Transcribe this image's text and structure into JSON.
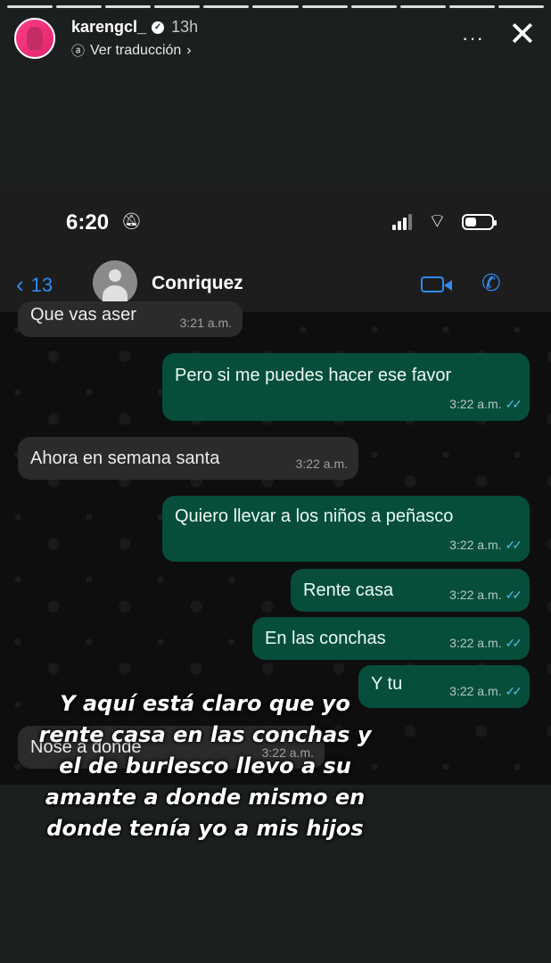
{
  "story": {
    "username": "karengcl_",
    "verified_mark": "✓",
    "time": "13h",
    "translate": "Ver traducción",
    "more": "···",
    "close": "✕",
    "caption": "Y aquí está claro que yo rente casa en las conchas y el de burlesco llevo a su amante a donde mismo en donde tenía yo a mis hijos"
  },
  "phone": {
    "time": "6:20",
    "back_count": "13",
    "contact": "Conriquez"
  },
  "messages": [
    {
      "dir": "in",
      "text": "Que vas aser",
      "time": "3:21 a.m."
    },
    {
      "dir": "out",
      "text": "Pero si me puedes hacer ese favor",
      "time": "3:22 a.m."
    },
    {
      "dir": "in",
      "text": "Ahora en semana santa",
      "time": "3:22 a.m."
    },
    {
      "dir": "out",
      "text": "Quiero llevar a los niños a peñasco",
      "time": "3:22 a.m."
    },
    {
      "dir": "out",
      "text": "Rente casa",
      "time": "3:22 a.m."
    },
    {
      "dir": "out",
      "text": "En las conchas",
      "time": "3:22 a.m."
    },
    {
      "dir": "out",
      "text": "Y tu",
      "time": "3:22 a.m."
    },
    {
      "dir": "in",
      "text": "Nose a donde",
      "time": "3:22 a.m."
    }
  ],
  "icons": {
    "bell_muted": "bell-slash-icon",
    "wifi": "wifi-icon",
    "battery": "battery-icon",
    "video": "video-call-icon",
    "phone": "phone-icon"
  },
  "colors": {
    "incoming_bubble": "#2a2b2b",
    "outgoing_bubble": "#064e3b",
    "accent": "#2e8bf0",
    "read_ticks": "#53bdeb"
  }
}
